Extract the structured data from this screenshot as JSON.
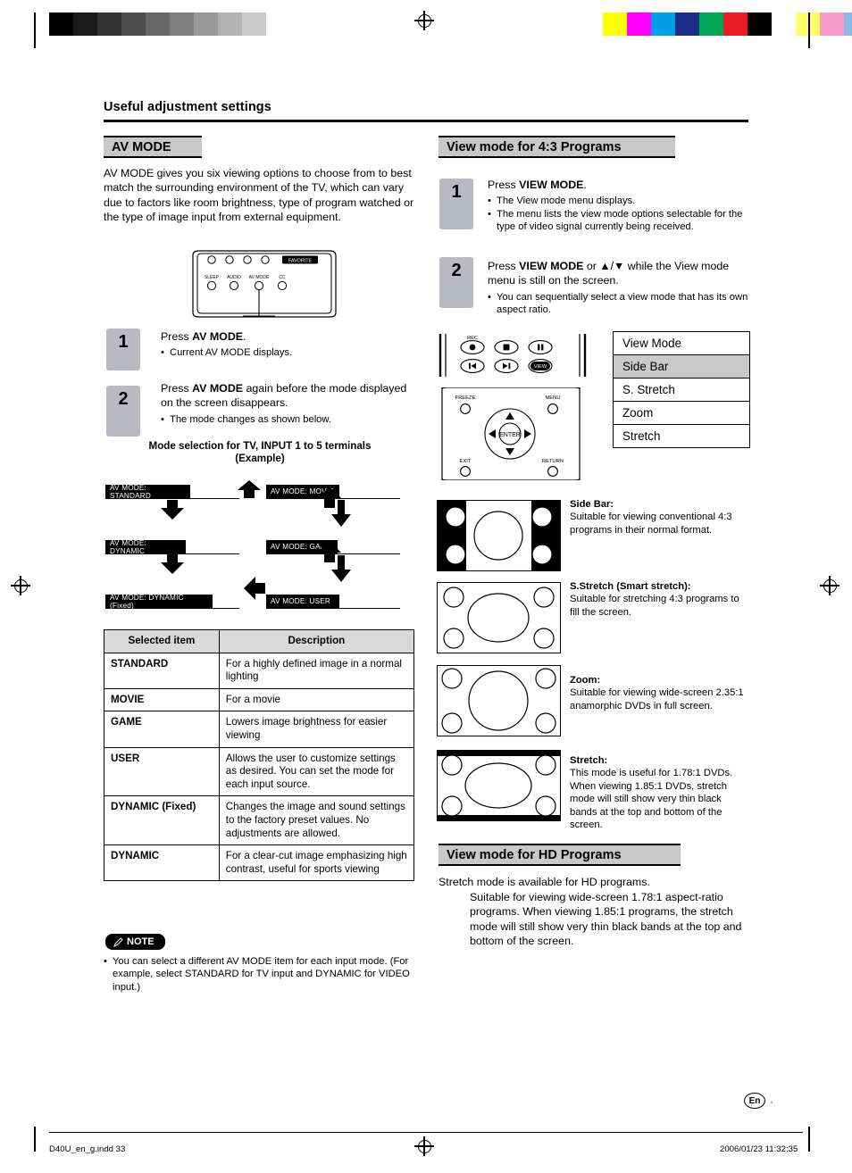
{
  "header": {
    "title": "Useful adjustment settings"
  },
  "left": {
    "banner": "AV MODE",
    "intro": "AV MODE gives you six viewing options to choose from to best match the surrounding environment of the TV, which can vary due to factors like room brightness, type of program watched or the type of image input from external equipment.",
    "remote_labels": {
      "favorite": "FAVORITE",
      "sleep": "SLEEP",
      "audio": "AUDIO",
      "avmode": "AV MODE",
      "cc": "CC"
    },
    "steps": [
      {
        "num": "1",
        "text_pre": "Press ",
        "text_bold": "AV MODE",
        "text_post": ".",
        "bullets": [
          "Current AV MODE displays."
        ]
      },
      {
        "num": "2",
        "text_pre": "Press ",
        "text_bold": "AV MODE",
        "text_post": " again before the mode displayed on the screen disappears.",
        "bullets": [
          "The mode changes as shown below."
        ]
      }
    ],
    "flow_title_1": "Mode selection for TV, INPUT 1 to 5 terminals",
    "flow_title_2": "(Example)",
    "flow": [
      "AV MODE: STANDARD",
      "AV MODE: MOVIE",
      "AV MODE: DYNAMIC",
      "AV MODE: GAME",
      "AV MODE: DYNAMIC (Fixed)",
      "AV MODE: USER"
    ],
    "table": {
      "headers": [
        "Selected item",
        "Description"
      ],
      "rows": [
        [
          "STANDARD",
          "For a highly defined image in a normal lighting"
        ],
        [
          "MOVIE",
          "For a movie"
        ],
        [
          "GAME",
          "Lowers image brightness for easier viewing"
        ],
        [
          "USER",
          "Allows the user to customize settings as desired. You can set the mode for each input source."
        ],
        [
          "DYNAMIC (Fixed)",
          "Changes the image and sound settings to the factory preset values. No adjustments are allowed."
        ],
        [
          "DYNAMIC",
          "For a clear-cut image emphasizing high contrast, useful for sports viewing"
        ]
      ]
    },
    "note_label": "NOTE",
    "note_text": "You can select a different AV MODE item for each input mode. (For example, select STANDARD for TV input and DYNAMIC for VIDEO input.)"
  },
  "right": {
    "banner_43": "View mode for 4:3 Programs",
    "steps": [
      {
        "num": "1",
        "text_pre": "Press ",
        "text_bold": "VIEW MODE",
        "text_post": ".",
        "bullets": [
          "The View mode menu displays.",
          "The menu lists the view mode options selectable for the type of video signal currently being received."
        ]
      },
      {
        "num": "2",
        "text_pre": "Press ",
        "text_bold": "VIEW MODE",
        "text_post": " or ▲/▼ while the View mode menu is still on the screen.",
        "bullets": [
          "You can sequentially select a view mode that has its own aspect ratio."
        ]
      }
    ],
    "remote_labels": {
      "rec": "REC",
      "freeze": "FREEZE",
      "menu": "MENU",
      "enter": "ENTER",
      "exit": "EXIT",
      "return": "RETURN",
      "view": "VIEW"
    },
    "menu": {
      "title": "View Mode",
      "items": [
        "Side Bar",
        "S. Stretch",
        "Zoom",
        "Stretch"
      ],
      "selected": "Side Bar"
    },
    "descriptions": [
      {
        "title": "Side Bar:",
        "text": "Suitable for viewing conventional 4:3 programs in their normal format."
      },
      {
        "title": "S.Stretch (Smart stretch):",
        "text": "Suitable for stretching 4:3 programs to fill the screen."
      },
      {
        "title": "Zoom:",
        "text": "Suitable for viewing wide-screen 2.35:1 anamorphic DVDs in full screen."
      },
      {
        "title": "Stretch:",
        "text": "This mode is useful for 1.78:1 DVDs. When viewing 1.85:1 DVDs, stretch mode will still show very thin black bands at the top and bottom of the screen."
      }
    ],
    "banner_hd": "View mode for HD Programs",
    "hd_line1": "Stretch mode is available for HD programs.",
    "hd_text": "Suitable for viewing wide-screen 1.78:1 aspect-ratio programs. When viewing 1.85:1 programs, the stretch mode will still show very thin black bands at the top and bottom of the screen."
  },
  "footer": {
    "left": "D40U_en_g.indd   33",
    "right": "2006/01/23   11:32:35",
    "page_badge": "En",
    "page_num": "·"
  },
  "colors": {
    "banner_bg": "#c8c8c8",
    "step_bg": "#b9b9c4",
    "table_head": "#d9d9d9",
    "menu_sel": "#c9c9c9"
  },
  "reg_left": [
    "#000000",
    "#1a1a1a",
    "#333333",
    "#4d4d4d",
    "#666666",
    "#808080",
    "#999999",
    "#b3b3b3",
    "#cccccc"
  ],
  "reg_right": [
    "#ffff00",
    "#ff00ff",
    "#00a0e9",
    "#1b2f8a",
    "#00a651",
    "#ed1c24",
    "#000000",
    "#ffffff",
    "#ffff66",
    "#f89bc8",
    "#8fb8e0",
    "#9a9a9a"
  ]
}
